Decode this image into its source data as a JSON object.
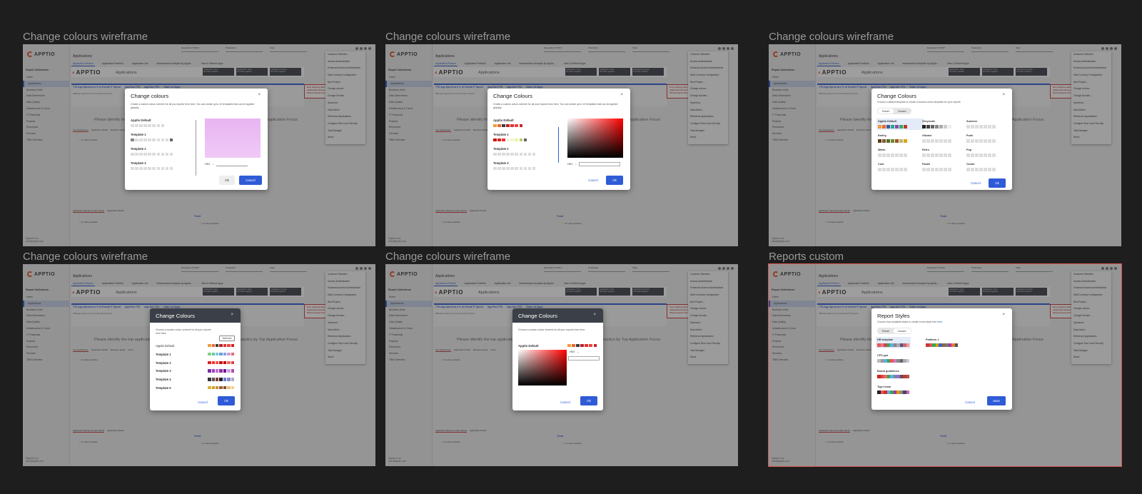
{
  "frames": [
    {
      "label": "Change colours wireframe"
    },
    {
      "label": "Change colours wireframe"
    },
    {
      "label": "Change colours wireframe"
    },
    {
      "label": "Change colours wireframe"
    },
    {
      "label": "Change colours wireframe"
    },
    {
      "label": "Reports custom"
    }
  ],
  "app": {
    "logo": "APPTIO",
    "page_title": "Applications",
    "app_name": "Applications",
    "tabs": [
      "Application Review",
      "Application Portfolio",
      "Application List",
      "Infrastructure Analysis by Applic...",
      "New & Retired Apps"
    ],
    "sidebar_title": "Report Collections",
    "sidebar_items": [
      "Home",
      "Applications",
      "Business Units",
      "Data Dimensions",
      "Data Quality",
      "Infrastructure & Cloud",
      "IT Financials",
      "Projects",
      "Resources",
      "Services",
      "TBM Overview"
    ],
    "user": "Signed in as",
    "user_email": "user@apptio.com",
    "filters": [
      "December FY2017",
      "Production",
      "Total"
    ],
    "banner_cells": [
      {
        "title": "Application Type",
        "value": "No Filter Applied"
      },
      {
        "title": "Application Tiers",
        "value": "No Filter Applied"
      },
      {
        "title": "Application Family",
        "value": "No Filter Applied"
      }
    ],
    "kpis": [
      "YTD App Spend as a % of Overall IT Spend",
      "App Run YTD",
      "App Dev YTD",
      "Total # of Apps"
    ],
    "kpi_sub": "IMB App Spend as % of Overall IT Spend",
    "alert": "Error obtaining data for KPI Widget. An relationship between Application and Planned Spend Fact table is not found.",
    "identify_left": "Please identify the top applications",
    "identify_right": "Application Focus",
    "identify_right_alt": "analytics by Top Application Focus",
    "section_tabs": [
      "Top Applications",
      "Application Detail",
      "Business detail",
      "Users"
    ],
    "no_data": "No data available",
    "lower_tabs": [
      "Application Spend by App Family",
      "Application Detail"
    ],
    "trend": "Trend",
    "menu": [
      "Customer Selection",
      "Access Administration",
      "Enhanced Access Administration",
      "Multi Currency Configuration",
      "New Project...",
      "Change colours",
      "Change Domain...",
      "Speedcon",
      "Data Admin",
      "Reference Applications",
      "Configure Row Level Security",
      "Task Manager",
      "About"
    ]
  },
  "dialog1": {
    "title": "Change colours",
    "close": "×",
    "desc": "Create a custom colour scheme for all you reports from here. You can create up to 10 templates that can be applied globally.",
    "templates": [
      "Apptio Default",
      "Template 1",
      "Template 2",
      "Template 3"
    ],
    "hex_label": "HEX",
    "ok": "Ok",
    "cancel": "Cancel",
    "preview_color": "#e6b3f0"
  },
  "dialog2": {
    "title": "Change Colours",
    "close": "×",
    "desc": "Create a custom colour scheme for all your reports from here. You can create up to 10 templates that can be applied globally.",
    "templates": [
      "Apptio Default",
      "Template 1",
      "Template 2",
      "Template 3"
    ],
    "hex_label": "HEX",
    "cancel": "Cancel",
    "ok": "Ok"
  },
  "dialog3": {
    "title": "Change Colours",
    "close": "×",
    "desc": "Choose a default template or create a custom colour template for your reports",
    "seg": [
      "Preset",
      "Custom"
    ],
    "palettes": [
      "Apptio Default",
      "Greyscale",
      "Summer",
      "Earthy",
      "Vibrant",
      "Punk",
      "Warm",
      "Retro",
      "Pop",
      "Cool",
      "Pastel",
      "Ocean"
    ],
    "cancel": "Cancel",
    "ok": "Ok"
  },
  "dialog4": {
    "title": "Change Colours",
    "close": "×",
    "desc": "Choose a custom colour scheme for all your reports from here.",
    "add_new": "Add new",
    "templates": [
      "Apptio Default",
      "Template 1",
      "Template 2",
      "Template 3",
      "Template 4",
      "Template 5"
    ],
    "cancel": "Cancel",
    "ok": "Ok"
  },
  "dialog5": {
    "title": "Change Colours",
    "close": "×",
    "desc": "Choose a custom colour scheme for all your reports from here.",
    "template": "Apptio Default",
    "hex_label": "HEX",
    "cancel": "Cancel",
    "ok": "Ok"
  },
  "dialog6": {
    "title": "Report Styles",
    "close": "×",
    "desc": "Choose from available styles or create a new style from",
    "desc_link": "here.",
    "seg": [
      "Preset",
      "Custom"
    ],
    "styles": [
      "HR template",
      "Platform 1",
      "CFO ppt",
      "Brand guidelines",
      "Tiger team"
    ],
    "cancel": "Cancel",
    "save": "Save"
  }
}
